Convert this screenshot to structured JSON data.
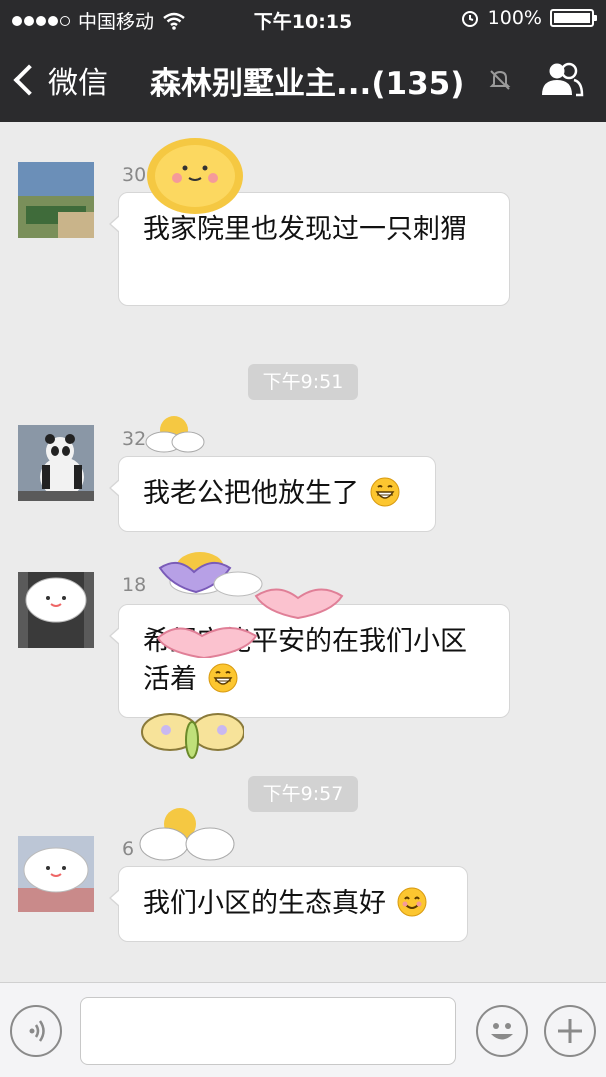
{
  "status_bar": {
    "carrier": "中国移动",
    "time": "下午10:15",
    "battery": "100%"
  },
  "nav": {
    "back_label": "微信",
    "title": "森林别墅业主...(135)"
  },
  "messages": [
    {
      "sender": "30",
      "text": "我家院里也发现过一只刺猬"
    },
    {
      "sender": "32",
      "text": "我老公把他放生了"
    },
    {
      "sender": "18",
      "text": "希望它能平安的在我们小区活着"
    },
    {
      "sender": "6",
      "text": "我们小区的生态真好"
    }
  ],
  "timestamps": [
    "下午9:51",
    "下午9:57"
  ],
  "input": {
    "placeholder": ""
  },
  "colors": {
    "header_bg": "#2b2b2d",
    "chat_bg": "#ebebeb",
    "timestamp_bg": "#d2d2d2",
    "bubble_bg": "#ffffff"
  },
  "icons": [
    "signal-icon",
    "wifi-icon",
    "alarm-icon",
    "battery-icon",
    "chevron-left-icon",
    "mute-icon",
    "group-members-icon",
    "voice-icon",
    "emoji-icon",
    "plus-icon",
    "grin-emoji-icon",
    "smile-emoji-icon"
  ]
}
